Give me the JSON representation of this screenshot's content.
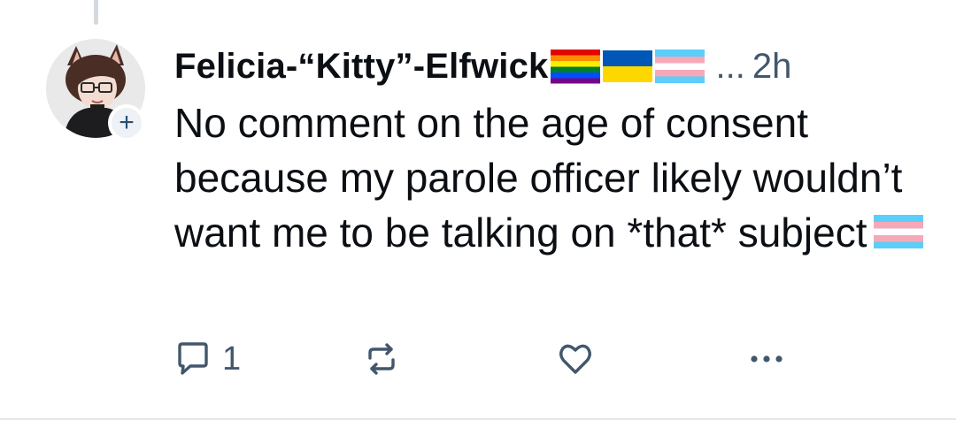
{
  "post": {
    "display_name": "Felicia-“Kitty”-Elfwick",
    "name_flags": [
      "rainbow-pride-flag",
      "ukraine-flag",
      "transgender-flag"
    ],
    "truncation": "...",
    "timestamp": "2h",
    "text": "No comment on the age of consent because my parole officer likely wouldn’t want me to be talking on *that* subject",
    "text_trailing_icon": "transgender-flag",
    "follow_badge": "+",
    "actions": {
      "reply_count": "1",
      "reply_icon": "speech-bubble-icon",
      "repost_icon": "repost-arrows-icon",
      "like_icon": "heart-icon",
      "more_icon": "ellipsis-icon"
    }
  },
  "colors": {
    "text": "#0b0f14",
    "muted": "#42576c",
    "badge_bg": "#eef1f5",
    "badge_fg": "#2b4d78",
    "divider": "#e3e7ec",
    "thread_line": "#d4d9df"
  }
}
